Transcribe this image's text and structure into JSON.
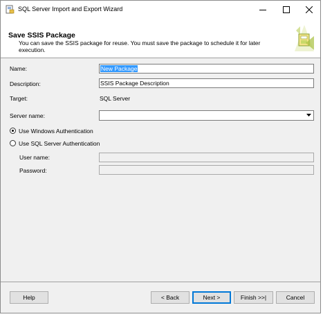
{
  "window": {
    "title": "SQL Server Import and Export Wizard"
  },
  "header": {
    "title": "Save SSIS Package",
    "description": "You can save the SSIS package for reuse. You must save the package to schedule it for later execution."
  },
  "form": {
    "name_label": "Name:",
    "name_value": "New Package",
    "description_label": "Description:",
    "description_value": "SSIS Package Description",
    "target_label": "Target:",
    "target_value": "SQL Server",
    "server_label": "Server name:",
    "server_value": "",
    "auth_windows_label": "Use Windows Authentication",
    "auth_sql_label": "Use SQL Server Authentication",
    "auth_selected": "windows",
    "username_label": "User name:",
    "username_value": "",
    "password_label": "Password:",
    "password_value": ""
  },
  "footer": {
    "help": "Help",
    "back": "< Back",
    "next": "Next >",
    "finish": "Finish >>|",
    "cancel": "Cancel"
  },
  "colors": {
    "selection": "#3399ff",
    "default_button_border": "#0078d7"
  }
}
